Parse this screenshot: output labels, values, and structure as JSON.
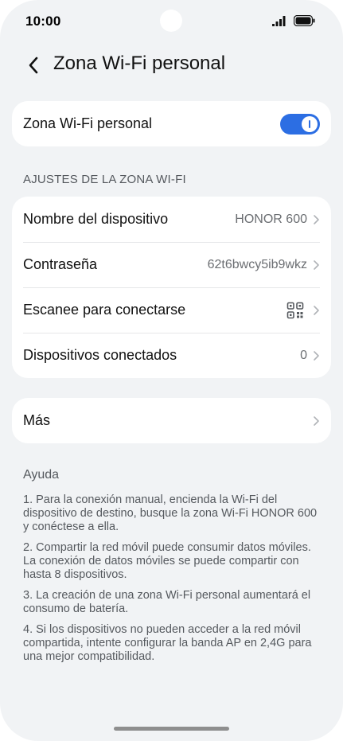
{
  "status_bar": {
    "time": "10:00"
  },
  "header": {
    "title": "Zona Wi-Fi personal"
  },
  "hotspot_toggle": {
    "label": "Zona Wi-Fi personal",
    "enabled": true
  },
  "settings_section": {
    "title": "AJUSTES DE LA ZONA WI-FI",
    "items": [
      {
        "label": "Nombre del dispositivo",
        "value": "HONOR 600"
      },
      {
        "label": "Contraseña",
        "value": "62t6bwcy5ib9wkz"
      },
      {
        "label": "Escanee para conectarse",
        "icon": "qr-code-icon"
      },
      {
        "label": "Dispositivos conectados",
        "value": "0"
      }
    ]
  },
  "more": {
    "label": "Más"
  },
  "help": {
    "title": "Ayuda",
    "items": [
      "1. Para la conexión manual, encienda la Wi-Fi del dispositivo de destino, busque la zona Wi-Fi HONOR 600 y conéctese a ella.",
      "2. Compartir la red móvil puede consumir datos móviles. La conexión de datos móviles se puede compartir con hasta 8 dispositivos.",
      "3. La creación de una zona Wi-Fi personal aumentará el consumo de batería.",
      "4. Si los dispositivos no pueden acceder a la red móvil compartida, intente configurar la banda AP en 2,4G para una mejor compatibilidad."
    ]
  },
  "colors": {
    "accent": "#2c6ee3",
    "background": "#f1f3f5",
    "card": "#ffffff"
  }
}
